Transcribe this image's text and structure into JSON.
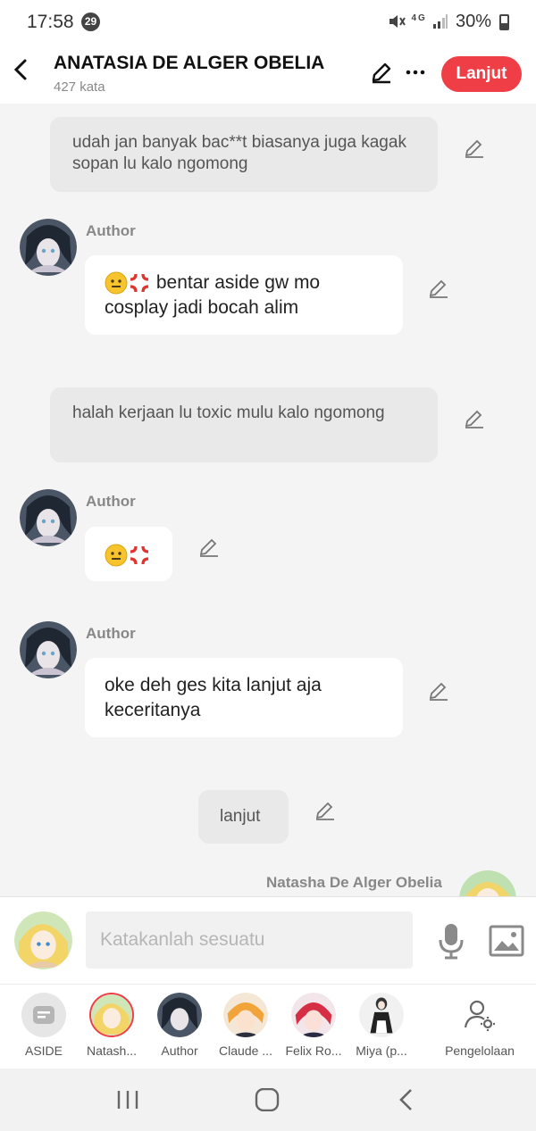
{
  "status_bar": {
    "time": "17:58",
    "notification_count": "29",
    "network": "4G",
    "battery": "30%"
  },
  "header": {
    "title": "ANATASIA DE ALGER OBELIA",
    "subtitle": "427 kata",
    "lanjut_label": "Lanjut"
  },
  "messages": [
    {
      "type": "narration",
      "text": "udah jan banyak bac**t biasanya juga kagak sopan lu kalo ngomong"
    },
    {
      "type": "character",
      "name": "Author",
      "text": "bentar aside gw mo cosplay jadi bocah alim",
      "emoji": [
        "smirk-face",
        "anger-symbol"
      ]
    },
    {
      "type": "narration",
      "text": "halah kerjaan lu toxic mulu kalo ngomong"
    },
    {
      "type": "character",
      "name": "Author",
      "text": "",
      "emoji": [
        "smirk-face",
        "anger-symbol"
      ]
    },
    {
      "type": "character",
      "name": "Author",
      "text": "oke deh ges kita lanjut aja keceritanya"
    },
    {
      "type": "narration",
      "text": "lanjut"
    },
    {
      "type": "character",
      "name": "Natasha De Alger Obelia",
      "text": ""
    }
  ],
  "input": {
    "placeholder": "Katakanlah sesuatu"
  },
  "characters": [
    {
      "label": "ASIDE",
      "icon": "aside-icon"
    },
    {
      "label": "Natash..."
    },
    {
      "label": "Author"
    },
    {
      "label": "Claude ..."
    },
    {
      "label": "Felix Ro..."
    },
    {
      "label": "Miya (p..."
    },
    {
      "label": "Pengelolaan",
      "icon": "user-settings-icon"
    }
  ],
  "colors": {
    "accent": "#ef3e45",
    "narration_bg": "#e9e9e9",
    "chat_bg": "#f4f4f4"
  }
}
